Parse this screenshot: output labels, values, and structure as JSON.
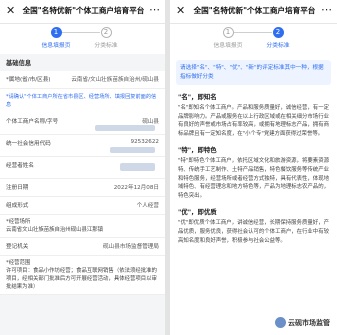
{
  "left": {
    "topbar": {
      "close_glyph": "✕",
      "title": "全国\"名特优新\"个体工商户培育平台",
      "more_glyph": "⋯"
    },
    "steps": [
      {
        "num": "1",
        "label": "信息填报页",
        "state": "active"
      },
      {
        "num": "2",
        "label": "分类标准",
        "state": "inactive"
      }
    ],
    "section_title": "基础信息",
    "rows": [
      {
        "label": "*属地(省/市/区县)",
        "value": "云南省/文山壮族苗族自治州/砚山县"
      },
      {
        "label": "个体工商户名称/字号",
        "value": "砚山县"
      },
      {
        "label": "统一社会信用代码",
        "value": "92532622"
      },
      {
        "label": "经营者姓名",
        "value": ""
      },
      {
        "label": "注册日期",
        "value": "2022年12月08日"
      },
      {
        "label": "组成形式",
        "value": "个人经营"
      },
      {
        "label": "登记机关",
        "value": "砚山县市场监督管理局"
      }
    ],
    "notice": "*请确认\"个体工商户所在省市县区、经营场所、填报回复前面的信息",
    "address_label": "*经营场所",
    "address_value": "云南省文山壮族苗族自治州砚山县江那镇",
    "scope_label": "*经营范围",
    "scope_value": "许可项目：食品小作坊经营；食品互联网销售（依法须经批准的项目，经相关部门批准后方可开展经营活动，具体经营项目以审批结果为准）"
  },
  "right": {
    "topbar": {
      "close_glyph": "✕",
      "title": "全国\"名特优新\"个体工商户培育平台",
      "more_glyph": "⋯"
    },
    "steps": [
      {
        "num": "1",
        "label": "信息填报页",
        "state": "inactive"
      },
      {
        "num": "2",
        "label": "分类标准",
        "state": "active"
      }
    ],
    "tip": "请选择\"名\"、\"特\"、\"优\"、\"新\"的评定标准其中一种，根据指标做好分类",
    "features": [
      {
        "title": "\"名\"，即知名",
        "body": "\"名\"即知名个体工商户。产品和服务质量好，诚信经营，有一定品牌影响力。产品或服务在以上行政区域或在相关细分市场行业有良好的声誉或市场占有率较高，或拥有地理标志产品，拥有商标品牌且有一定知名度，在\"小个专\"党建方面获得过荣誉等。"
      },
      {
        "title": "\"特\"，即特色",
        "body": "\"特\"即特色个体工商户，依托区域文化和旅游资源，将要素资源特、传统手工艺制作、土特产品销售，特色餐饮服务等传统产业和特色服务，经营场所或者经营方式独特，具有代表性，体现地域特色、有经营理念和地方特色等，产品为地理标志农产品的，特色突出。"
      },
      {
        "title": "\"优\"，即优质",
        "body": "\"优\"即优质个体工商户，讲诚信经营，长期保持服务质量好，产品优质，服务优良，获得社会认可的个体工商户，在行业中有较高知名度和良好声誉，积极参与社会公益等。"
      }
    ],
    "watermark": "云砚市场监管"
  }
}
